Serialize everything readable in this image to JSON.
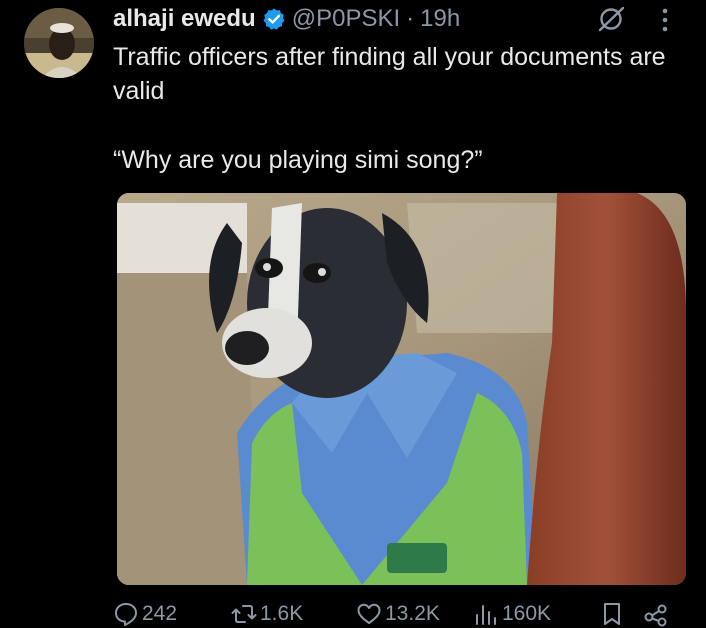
{
  "tweet": {
    "display_name": "alhaji ewedu",
    "handle": "@P0PSKI",
    "separator": "·",
    "time": "19h",
    "text_line1": "Traffic officers after finding all your documents are valid",
    "text_line2": "“Why are you playing simi song?”"
  },
  "icons": {
    "verified": "verified-badge-icon",
    "grok": "grok-icon",
    "more": "more-options-icon",
    "reply": "reply-icon",
    "retweet": "retweet-icon",
    "like": "heart-icon",
    "views": "views-icon",
    "bookmark": "bookmark-icon",
    "share": "share-icon"
  },
  "actions": {
    "replies": "242",
    "retweets": "1.6K",
    "likes": "13.2K",
    "views": "160K"
  },
  "colors": {
    "background": "#000000",
    "text": "#e7e9ea",
    "secondary": "#8b98a5",
    "verified": "#1d9bf0",
    "uniform_blue": "#5a8ad0",
    "vest_green": "#7cc05a"
  }
}
